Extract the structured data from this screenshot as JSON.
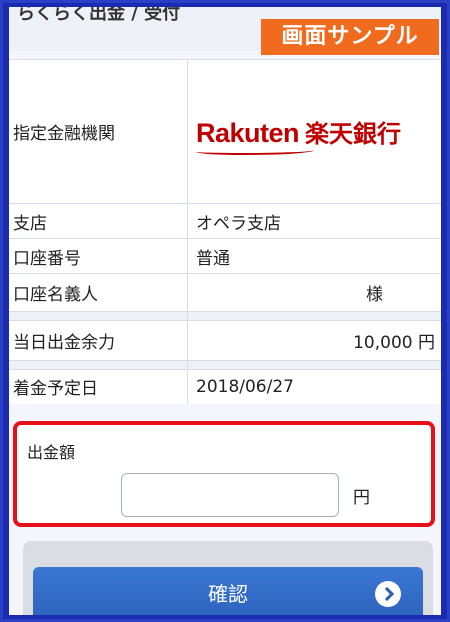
{
  "header": {
    "title": "らくらく出金 / 受付",
    "sample_badge": "画面サンプル"
  },
  "rows": {
    "bank_label": "指定金融機関",
    "bank_logo_word": "Rakuten",
    "bank_logo_jp": "楽天銀行",
    "branch_label": "支店",
    "branch_value": "オペラ支店",
    "account_no_label": "口座番号",
    "account_no_value": "普通",
    "holder_label": "口座名義人",
    "holder_value": "様",
    "balance_label": "当日出金余力",
    "balance_value": "10,000 円",
    "arrival_label": "着金予定日",
    "arrival_value": "2018/06/27"
  },
  "amount": {
    "label": "出金額",
    "value": "",
    "unit": "円"
  },
  "confirm_button": {
    "label": "確認"
  }
}
